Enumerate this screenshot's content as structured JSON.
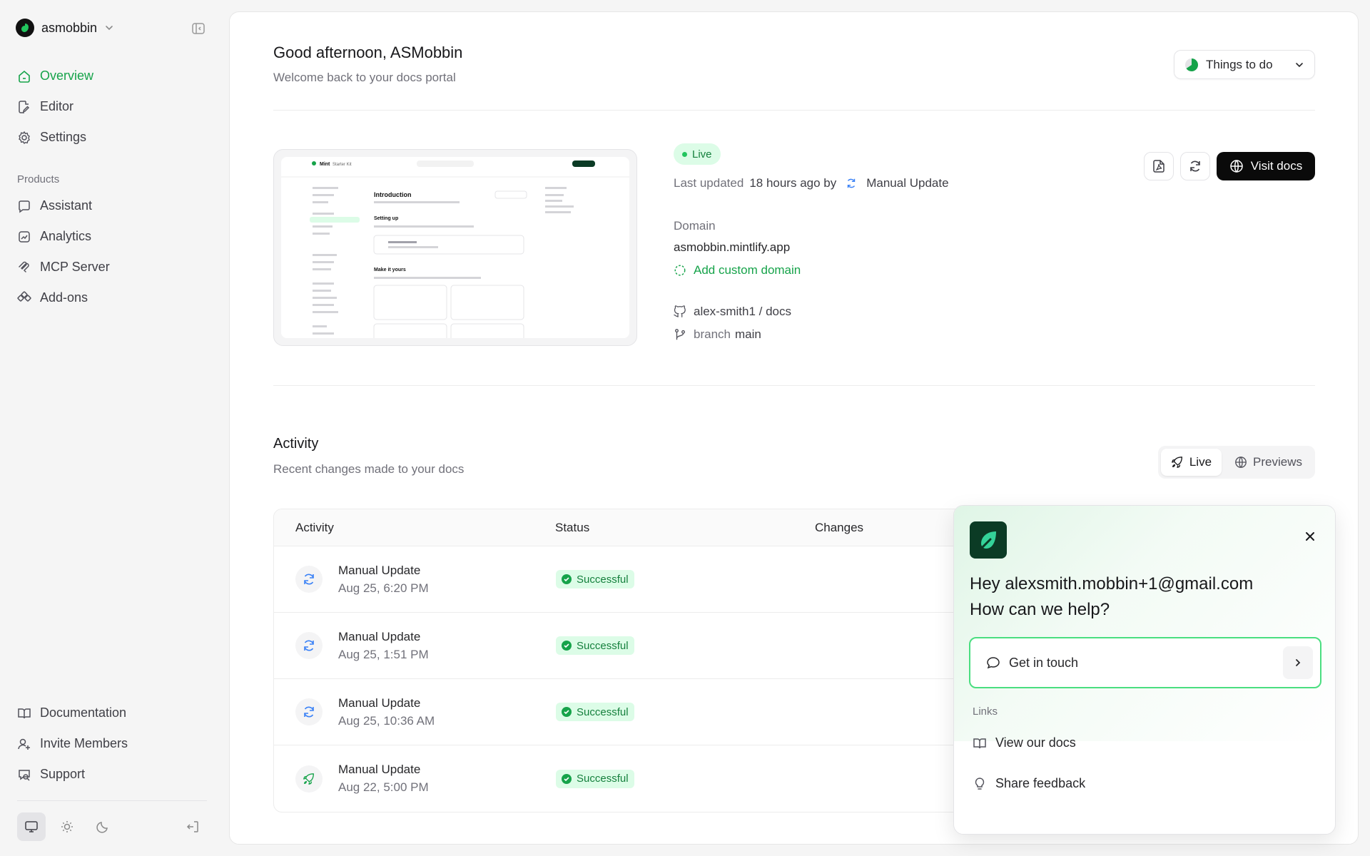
{
  "sidebar": {
    "org_name": "asmobbin",
    "nav": [
      {
        "label": "Overview",
        "icon": "home-icon"
      },
      {
        "label": "Editor",
        "icon": "editor-icon"
      },
      {
        "label": "Settings",
        "icon": "gear-icon"
      }
    ],
    "products_label": "Products",
    "products": [
      {
        "label": "Assistant",
        "icon": "assistant-icon"
      },
      {
        "label": "Analytics",
        "icon": "analytics-icon"
      },
      {
        "label": "MCP Server",
        "icon": "mcp-icon"
      },
      {
        "label": "Add-ons",
        "icon": "addons-icon"
      }
    ],
    "footer": [
      {
        "label": "Documentation",
        "icon": "book-icon"
      },
      {
        "label": "Invite Members",
        "icon": "invite-icon"
      },
      {
        "label": "Support",
        "icon": "support-icon"
      }
    ]
  },
  "header": {
    "greeting": "Good afternoon, ASMobbin",
    "subtitle": "Welcome back to your docs portal",
    "todo_label": "Things to do"
  },
  "deployment": {
    "status": "Live",
    "last_updated_prefix": "Last updated",
    "last_updated_time": "18 hours ago by",
    "last_updated_by": "Manual Update",
    "domain_label": "Domain",
    "domain": "asmobbin.mintlify.app",
    "add_domain": "Add custom domain",
    "repo": "alex-smith1 / docs",
    "branch_label": "branch",
    "branch": "main",
    "visit_label": "Visit docs"
  },
  "preview": {
    "brand": "Mint",
    "kit": "Starter Kit",
    "title": "Introduction",
    "setup": "Setting up",
    "make": "Make it yours"
  },
  "activity": {
    "title": "Activity",
    "subtitle": "Recent changes made to your docs",
    "toggle": {
      "live": "Live",
      "previews": "Previews"
    },
    "columns": [
      "Activity",
      "Status",
      "Changes"
    ],
    "rows": [
      {
        "title": "Manual Update",
        "date": "Aug 25, 6:20 PM",
        "status": "Successful",
        "icon": "refresh-icon"
      },
      {
        "title": "Manual Update",
        "date": "Aug 25, 1:51 PM",
        "status": "Successful",
        "icon": "refresh-icon"
      },
      {
        "title": "Manual Update",
        "date": "Aug 25, 10:36 AM",
        "status": "Successful",
        "icon": "refresh-icon"
      },
      {
        "title": "Manual Update",
        "date": "Aug 22, 5:00 PM",
        "status": "Successful",
        "icon": "rocket-icon"
      }
    ]
  },
  "help": {
    "greeting_line1": "Hey alexsmith.mobbin+1@gmail.com",
    "greeting_line2": "How can we help?",
    "get_in_touch": "Get in touch",
    "links_label": "Links",
    "links": [
      "View our docs",
      "Share feedback"
    ]
  },
  "colors": {
    "accent": "#16a34a",
    "success_bg": "#dcfce7",
    "primary_button": "#0a0a0a"
  }
}
